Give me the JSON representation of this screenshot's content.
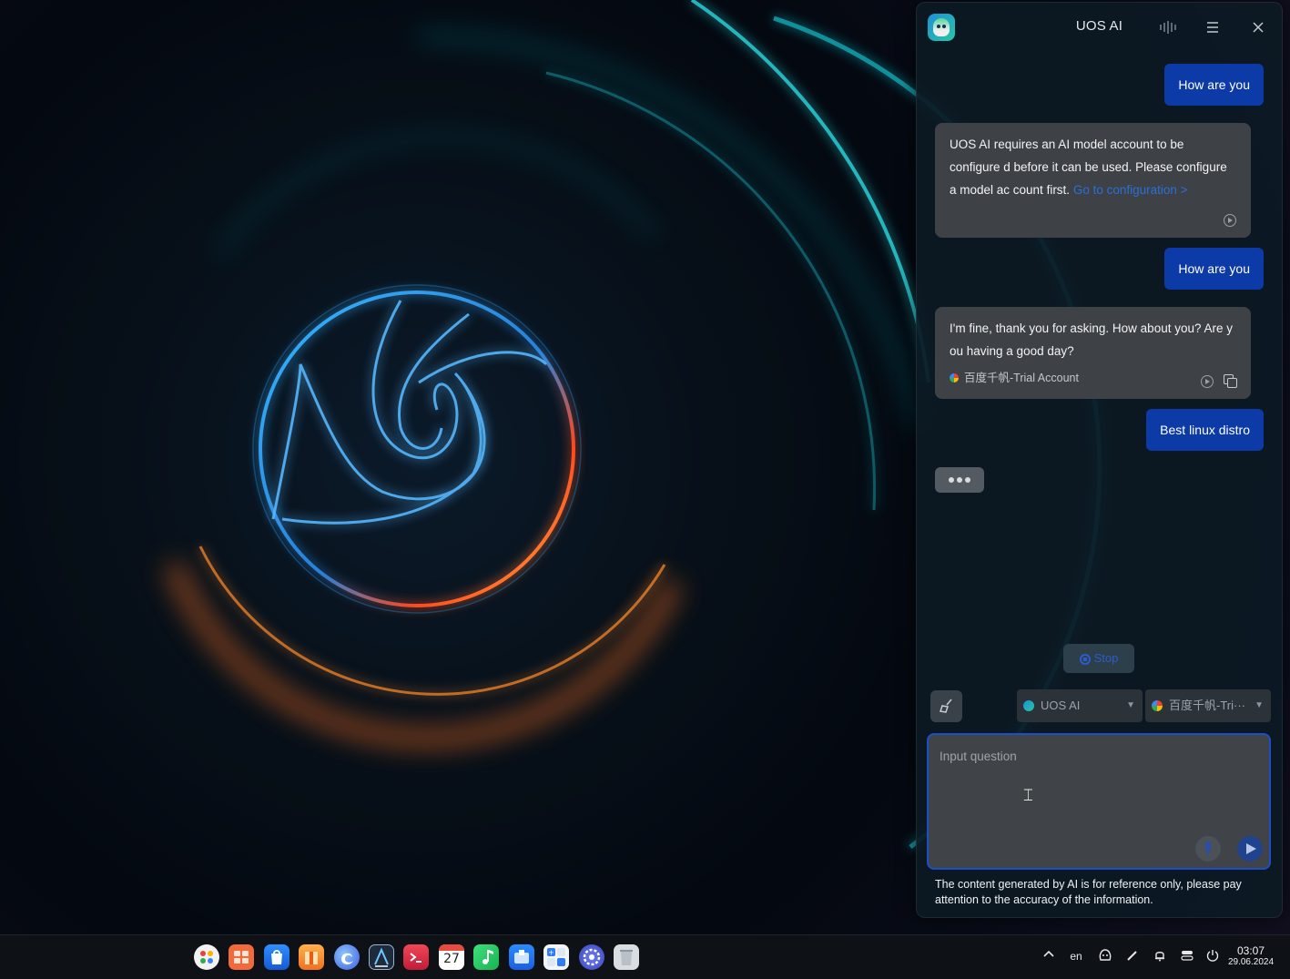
{
  "panel": {
    "title": "UOS AI",
    "messages": [
      {
        "role": "user",
        "text": "How are you"
      },
      {
        "role": "ai",
        "text": "UOS AI requires an AI model account to be configure d before it can be used. Please configure a model ac count first.",
        "link": "Go to configuration >"
      },
      {
        "role": "user",
        "text": "How are you"
      },
      {
        "role": "ai",
        "text": "I'm fine, thank you for asking. How about you? Are y ou having a good day?",
        "model": "百度千帆-Trial Account"
      },
      {
        "role": "user",
        "text": "Best linux distro"
      }
    ],
    "stop_label": "Stop",
    "assistant_select": "UOS AI",
    "model_select": "百度千帆-Tri···",
    "input_placeholder": "Input question",
    "disclaimer": "The content generated by AI is for reference only, please pay attention to the accuracy of the information."
  },
  "taskbar": {
    "dock_apps": [
      "launcher-icon",
      "multitask-icon",
      "app-store-icon",
      "archive-icon",
      "browser-icon",
      "text-editor-icon",
      "terminal-icon",
      "calendar-icon",
      "music-icon",
      "file-manager-icon",
      "calculator-icon",
      "control-center-icon",
      "trash-icon"
    ],
    "calendar_day": "27",
    "language": "en",
    "time": "03:07",
    "date": "29.06.2024"
  },
  "colors": {
    "accent": "#0c3aa6",
    "ai_bubble": "#3e4247",
    "panel_bg": "#0c1a24",
    "link": "#2b6ed8"
  }
}
